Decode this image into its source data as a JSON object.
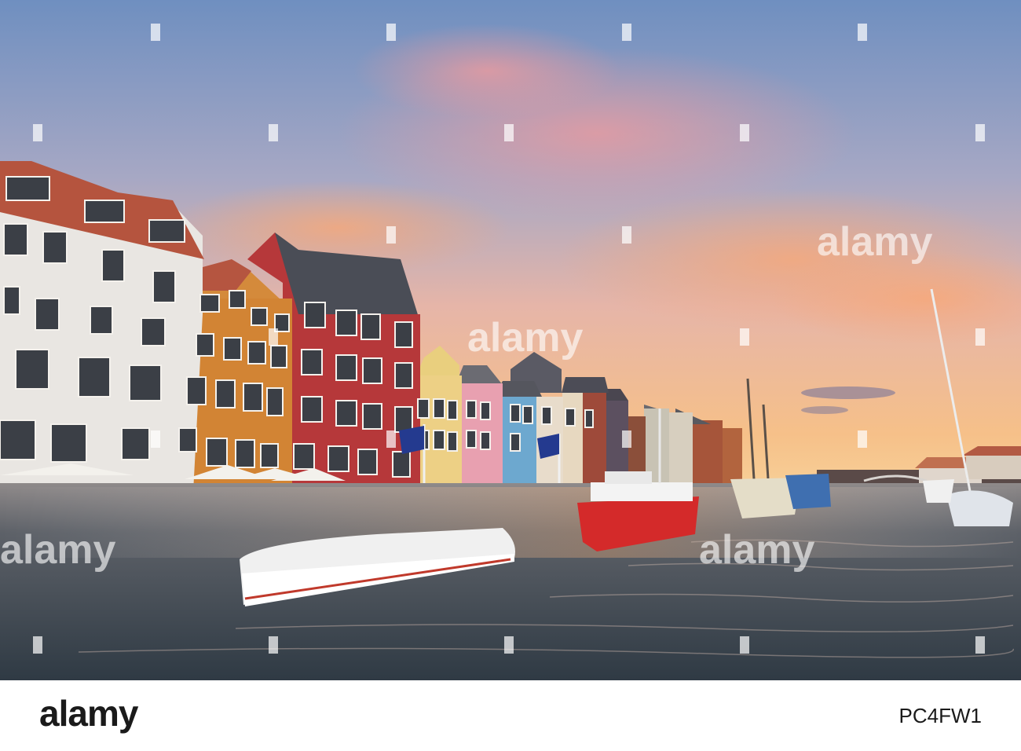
{
  "footer": {
    "brand": "alamy",
    "image_id": "PC4FW1"
  },
  "watermark": {
    "text": "alamy"
  },
  "colors": {
    "sky_top": "#6f8fc0",
    "sky_mid": "#c8a4b6",
    "sky_glow": "#f6c089",
    "water": "#4a5560",
    "red_building": "#b6383a",
    "orange_building": "#d48a3b",
    "white_building": "#e9e6e2",
    "red_boat": "#d42a2a"
  }
}
